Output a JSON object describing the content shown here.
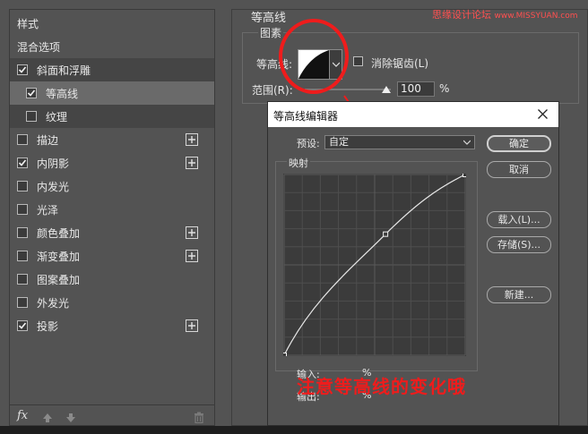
{
  "sidebar": {
    "items": [
      {
        "label": "样式",
        "checkbox": false,
        "checked": false,
        "plus": false
      },
      {
        "label": "混合选项",
        "checkbox": false,
        "checked": false,
        "plus": false
      },
      {
        "label": "斜面和浮雕",
        "checkbox": true,
        "checked": true,
        "plus": false
      },
      {
        "label": "等高线",
        "checkbox": true,
        "checked": true,
        "plus": false
      },
      {
        "label": "纹理",
        "checkbox": true,
        "checked": false,
        "plus": false
      },
      {
        "label": "描边",
        "checkbox": true,
        "checked": false,
        "plus": true
      },
      {
        "label": "内阴影",
        "checkbox": true,
        "checked": true,
        "plus": true
      },
      {
        "label": "内发光",
        "checkbox": true,
        "checked": false,
        "plus": false
      },
      {
        "label": "光泽",
        "checkbox": true,
        "checked": false,
        "plus": false
      },
      {
        "label": "颜色叠加",
        "checkbox": true,
        "checked": false,
        "plus": true
      },
      {
        "label": "渐变叠加",
        "checkbox": true,
        "checked": false,
        "plus": true
      },
      {
        "label": "图案叠加",
        "checkbox": true,
        "checked": false,
        "plus": false
      },
      {
        "label": "外发光",
        "checkbox": true,
        "checked": false,
        "plus": false
      },
      {
        "label": "投影",
        "checkbox": true,
        "checked": true,
        "plus": true
      }
    ],
    "fx_label": "fx"
  },
  "panel": {
    "heading": "等高线",
    "group_title": "图素",
    "contour_label": "等高线:",
    "antialias_label": "消除锯齿(L)",
    "range_label": "范围(R):",
    "range_value": "100",
    "range_unit": "%",
    "range_fraction": 0.95
  },
  "watermark": {
    "cn": "思缘设计论坛",
    "url": "www.MISSYUAN.com"
  },
  "dialog": {
    "title": "等高线编辑器",
    "preset_label": "预设:",
    "preset_value": "自定",
    "mapping_label": "映射",
    "buttons": {
      "ok": "确定",
      "cancel": "取消",
      "load": "载入(L)...",
      "save": "存储(S)...",
      "new": "新建..."
    },
    "input_label": "输入:",
    "output_label": "输出:",
    "input_value": "",
    "output_value": "",
    "percent": "%",
    "curve_points": [
      [
        0,
        0
      ],
      [
        0.56,
        0.67
      ],
      [
        1,
        1
      ]
    ]
  },
  "annotation": {
    "text": "注意等高线的变化哦",
    "color": "#ef1c1c"
  }
}
